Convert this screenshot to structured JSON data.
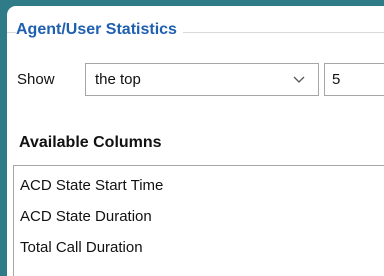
{
  "group": {
    "title": "Agent/User Statistics"
  },
  "show": {
    "label": "Show",
    "selected": "the top",
    "count": "5"
  },
  "columns": {
    "title": "Available Columns",
    "items": [
      {
        "label": "ACD State Start Time"
      },
      {
        "label": "ACD State Duration"
      },
      {
        "label": "Total Call Duration"
      }
    ]
  },
  "colors": {
    "background": "#2f7c88",
    "group_title": "#1f5fb0",
    "border": "#a6a6a6"
  },
  "icons": {
    "dropdown": "chevron-down-icon"
  }
}
